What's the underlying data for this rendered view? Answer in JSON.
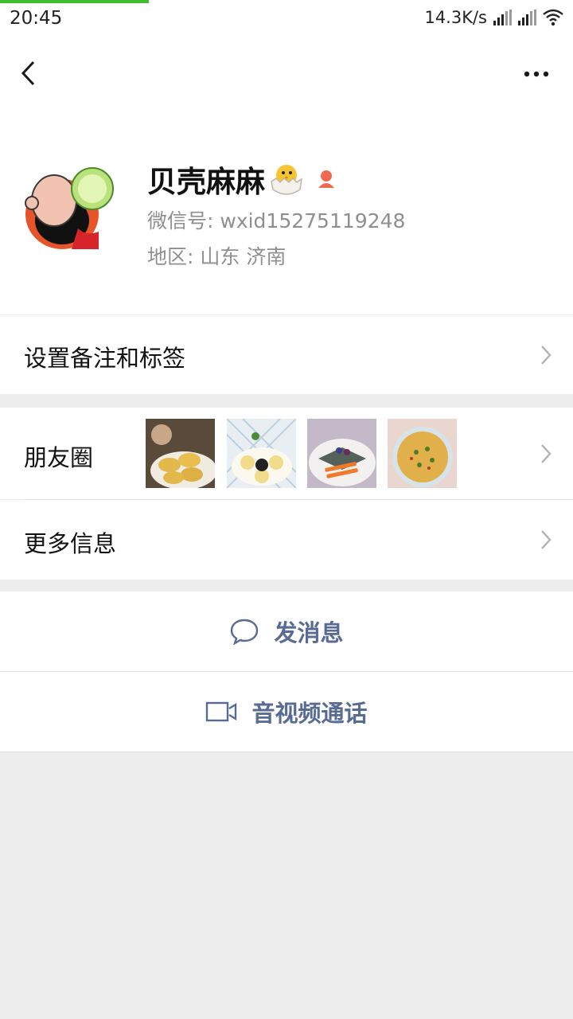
{
  "status_bar": {
    "time": "20:45",
    "net_speed": "14.3K/s",
    "load_progress": 0.26
  },
  "profile": {
    "nickname": "贝壳麻麻",
    "wechat_id": "微信号: wxid15275119248",
    "region": "地区: 山东  济南",
    "gender_icon": "female-icon"
  },
  "menu": {
    "remark_label": "设置备注和标签",
    "moments_label": "朋友圈",
    "more_info_label": "更多信息"
  },
  "actions": {
    "send_message": "发消息",
    "av_call": "音视频通话"
  },
  "colors": {
    "accent": "#576b95",
    "progress": "#3fbf2f",
    "female": "#f06a4f"
  }
}
